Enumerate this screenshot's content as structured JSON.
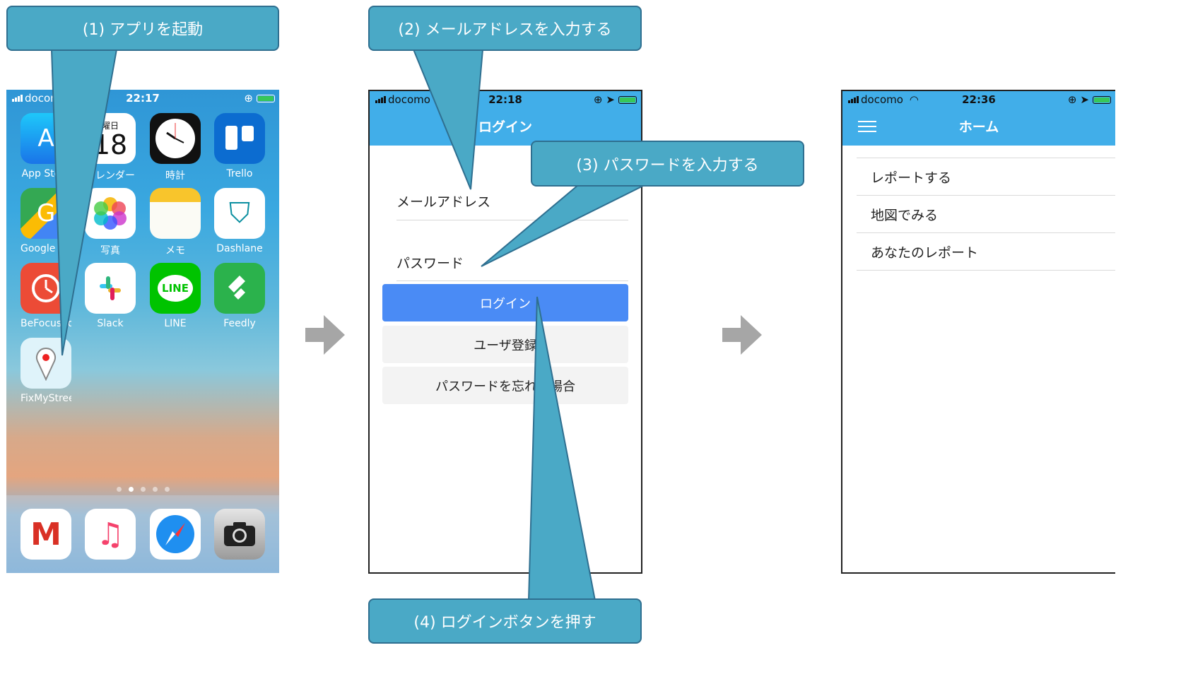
{
  "callouts": {
    "step1": "(1) アプリを起動",
    "step2": "(2) メールアドレスを入力する",
    "step3": "(3) パスワードを入力する",
    "step4": "(4) ログインボタンを押す"
  },
  "phone1": {
    "status": {
      "carrier": "docomo",
      "time": "22:17"
    },
    "calendar": {
      "weekday": "曜日",
      "day": "18"
    },
    "apps": [
      {
        "label": "App Store",
        "icon": "app-store-icon"
      },
      {
        "label": "カレンダー",
        "icon": "calendar-icon"
      },
      {
        "label": "時計",
        "icon": "clock-icon"
      },
      {
        "label": "Trello",
        "icon": "trello-icon"
      },
      {
        "label": "Google Maps",
        "icon": "google-maps-icon"
      },
      {
        "label": "写真",
        "icon": "photos-icon"
      },
      {
        "label": "メモ",
        "icon": "notes-icon"
      },
      {
        "label": "Dashlane",
        "icon": "dashlane-icon"
      },
      {
        "label": "BeFocused Pro",
        "icon": "befocused-icon"
      },
      {
        "label": "Slack",
        "icon": "slack-icon"
      },
      {
        "label": "LINE",
        "icon": "line-icon"
      },
      {
        "label": "Feedly",
        "icon": "feedly-icon"
      },
      {
        "label": "FixMyStreetJ...",
        "icon": "fixmystreet-icon"
      }
    ],
    "line_icon_text": "LINE",
    "dock": [
      "gmail-icon",
      "music-icon",
      "safari-icon",
      "camera-icon"
    ],
    "page_dots": 5,
    "active_dot": 1
  },
  "phone2": {
    "status": {
      "carrier": "docomo",
      "time": "22:18"
    },
    "title": "ログイン",
    "email_label": "メールアドレス",
    "password_label": "パスワード",
    "login_button": "ログイン",
    "register_button": "ユーザ登録",
    "forgot_button": "パスワードを忘れた場合"
  },
  "phone3": {
    "status": {
      "carrier": "docomo",
      "time": "22:36"
    },
    "title": "ホーム",
    "menu": [
      "レポートする",
      "地図でみる",
      "あなたのレポート"
    ]
  },
  "colors": {
    "callout": "#4aa9c6",
    "appbar": "#41aee9",
    "primary_button": "#4a8bf5",
    "arrow": "#a6a6a6"
  }
}
